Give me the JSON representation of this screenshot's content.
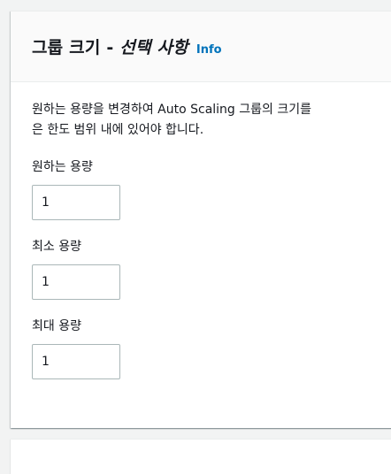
{
  "group_size": {
    "title_prefix": "그룹 크기 - ",
    "title_optional": "선택 사항",
    "info_label": "Info",
    "description_line1": "원하는 용량을 변경하여 Auto Scaling 그룹의 크기를",
    "description_line2": "은 한도 범위 내에 있어야 합니다.",
    "fields": [
      {
        "label": "원하는 용량",
        "value": "1"
      },
      {
        "label": "최소 용량",
        "value": "1"
      },
      {
        "label": "최대 용량",
        "value": "1"
      }
    ]
  }
}
